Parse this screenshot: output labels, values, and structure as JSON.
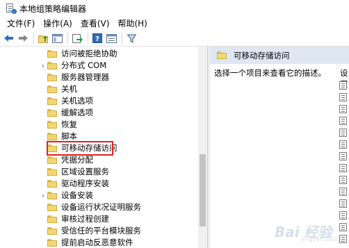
{
  "window": {
    "title": "本地组策略编辑器"
  },
  "menu": {
    "items": [
      "文件(F)",
      "操作(A)",
      "查看(V)",
      "帮助(H)"
    ]
  },
  "toolbar": {
    "buttons": [
      "back-arrow-icon",
      "forward-arrow-icon",
      "up-folder-icon",
      "show-hide-tree-icon",
      "export-list-icon",
      "help-icon",
      "properties-icon",
      "filter-icon"
    ]
  },
  "tree": {
    "items": [
      {
        "label": "访问被拒绝协助",
        "expandable": false,
        "selected": false
      },
      {
        "label": "分布式 COM",
        "expandable": true,
        "selected": false
      },
      {
        "label": "服务器管理器",
        "expandable": false,
        "selected": false
      },
      {
        "label": "关机",
        "expandable": false,
        "selected": false
      },
      {
        "label": "关机选项",
        "expandable": false,
        "selected": false
      },
      {
        "label": "缓解选项",
        "expandable": false,
        "selected": false
      },
      {
        "label": "恢复",
        "expandable": false,
        "selected": false
      },
      {
        "label": "脚本",
        "expandable": false,
        "selected": false
      },
      {
        "label": "可移动存储访问",
        "expandable": false,
        "selected": true
      },
      {
        "label": "凭据分配",
        "expandable": false,
        "selected": false
      },
      {
        "label": "区域设置服务",
        "expandable": false,
        "selected": false
      },
      {
        "label": "驱动程序安装",
        "expandable": false,
        "selected": false
      },
      {
        "label": "设备安装",
        "expandable": true,
        "selected": false
      },
      {
        "label": "设备运行状况证明服务",
        "expandable": false,
        "selected": false
      },
      {
        "label": "审核过程创建",
        "expandable": false,
        "selected": false
      },
      {
        "label": "受信任的平台模块服务",
        "expandable": false,
        "selected": false
      },
      {
        "label": "提前启动反恶意软件",
        "expandable": false,
        "selected": false
      }
    ]
  },
  "detail": {
    "header_title": "可移动存储访问",
    "description": "选择一个项目来查看它的描述。",
    "settings_column_label": "设置"
  },
  "watermark": {
    "text": "Bai 经验",
    "sub": "jingyan.baidu.com"
  },
  "colors": {
    "highlight_border": "#e02020",
    "header_bg": "#dfe7f2",
    "folder_fill": "#f2d675"
  }
}
